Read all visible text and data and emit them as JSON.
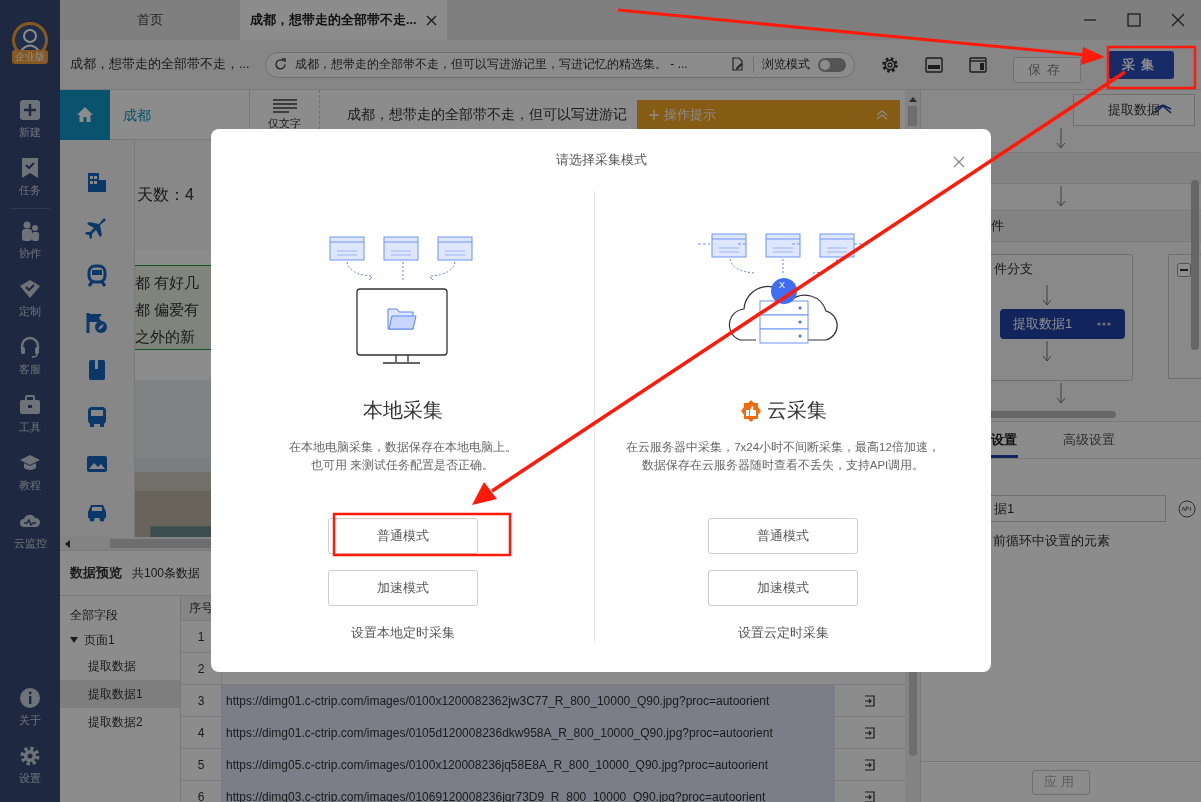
{
  "sidebar": {
    "badge": "企业版",
    "items": [
      {
        "label": "新建"
      },
      {
        "label": "任务"
      },
      {
        "label": "协作"
      },
      {
        "label": "定制"
      },
      {
        "label": "客服"
      },
      {
        "label": "工具"
      },
      {
        "label": "教程"
      },
      {
        "label": "云监控"
      }
    ],
    "bottom_items": [
      {
        "label": "关于"
      },
      {
        "label": "设置"
      }
    ]
  },
  "tabs": [
    {
      "label": "首页",
      "selected": false
    },
    {
      "label": "成都，想带走的全部带不走...",
      "selected": true
    }
  ],
  "toolbar": {
    "page_title": "成都，想带走的全部带不走，...",
    "address": "成都，想带走的全部带不走，但可以写进游记里，写进记忆的精选集。 - ...",
    "browse_mode": {
      "label": "浏览模式",
      "on": false
    },
    "save_button": {
      "label": "保存",
      "disabled": true
    },
    "collect_button": {
      "label": "采集"
    }
  },
  "browser": {
    "home_title": "成都",
    "view_label": "仅文字",
    "headline": "成都，想带走的全部带不走，但可以写进游记",
    "tips": {
      "title": "操作提示",
      "expanded": true
    },
    "days": "天数：4",
    "highlight_lines": [
      "都 有好几",
      "都 偏爱有",
      "之外的新"
    ]
  },
  "data_preview": {
    "title": "数据预览",
    "count": "共100条数据",
    "fields": [
      {
        "label": "全部字段"
      },
      {
        "label": "页面1",
        "expanded": true,
        "children": [
          {
            "label": "提取数据",
            "selected": false
          },
          {
            "label": "提取数据1",
            "selected": true
          },
          {
            "label": "提取数据2",
            "selected": false
          }
        ]
      }
    ],
    "columns": [
      "序号"
    ],
    "rows": [
      {
        "index": "1"
      },
      {
        "index": "2"
      },
      {
        "index": "3",
        "url": "https://dimg01.c-ctrip.com/images/0100x1200082362jw3C77_R_800_10000_Q90.jpg?proc=autoorient"
      },
      {
        "index": "4",
        "url": "https://dimg01.c-ctrip.com/images/0105d120008236dkw958A_R_800_10000_Q90.jpg?proc=autoorient"
      },
      {
        "index": "5",
        "url": "https://dimg05.c-ctrip.com/images/0100x120008236jq58E8A_R_800_10000_Q90.jpg?proc=autoorient"
      },
      {
        "index": "6",
        "url": "https://dimg03.c-ctrip.com/images/01069120008236jqr73D9_R_800_10000_Q90.jpg?proc=autoorient"
      }
    ]
  },
  "workflow": {
    "top_step": "提取数据",
    "step": "件",
    "branch": {
      "label": "件分支",
      "node": "提取数据1"
    },
    "tabs": [
      {
        "label": "设置",
        "selected": true
      },
      {
        "label": "高级设置",
        "selected": false
      }
    ],
    "name_field": "据1",
    "option_text": "前循环中设置的元素",
    "apply_button": {
      "label": "应用",
      "disabled": true
    }
  },
  "dialog": {
    "title": "请选择采集模式",
    "options": [
      {
        "kind": "local",
        "title": "本地采集",
        "description": [
          "在本地电脑采集，数据保存在本地电脑上。",
          "也可用 来测试任务配置是否正确。"
        ],
        "buttons": [
          "普通模式",
          "加速模式"
        ],
        "schedule_link": "设置本地定时采集"
      },
      {
        "kind": "cloud",
        "title": "云采集",
        "speed_badge": "X",
        "description": [
          "在云服务器中采集，7x24小时不间断采集，最高12倍加速，",
          "数据保存在云服务器随时查看不丢失，支持API调用。"
        ],
        "buttons": [
          "普通模式",
          "加速模式"
        ],
        "schedule_link": "设置云定时采集"
      }
    ]
  }
}
